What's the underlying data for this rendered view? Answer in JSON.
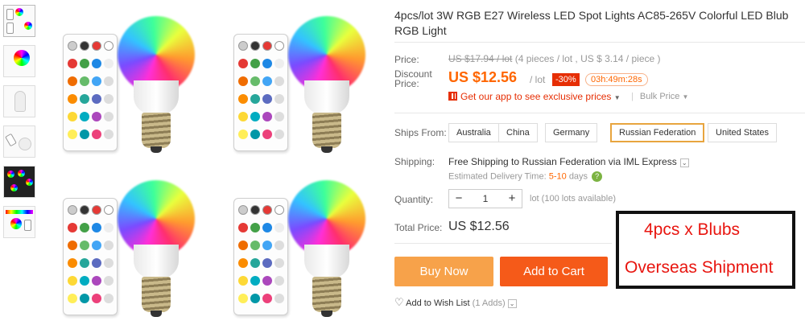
{
  "product": {
    "title": "4pcs/lot 3W RGB E27 Wireless LED Spot Lights AC85-265V Colorful LED Blub RGB Light"
  },
  "thumbnails": [
    "4-pack view",
    "single bulb",
    "bulb front",
    "bulb with remote",
    "color effects",
    "color spectrum"
  ],
  "price": {
    "label": "Price:",
    "original": "US $17.94 / lot",
    "per_piece": "(4 pieces / lot , US $ 3.14 / piece )",
    "discount_label": "Discount Price:",
    "sale": "US $12.56",
    "per_lot": "/ lot",
    "discount_badge": "-30%",
    "countdown": "03h:49m:28s",
    "app_promo": "Get our app to see exclusive prices",
    "bulk": "Bulk Price"
  },
  "ships_from": {
    "label": "Ships From:",
    "options": [
      "Australia",
      "China",
      "Germany",
      "Russian Federation",
      "United States"
    ],
    "selected": "Russian Federation"
  },
  "shipping": {
    "label": "Shipping:",
    "text": "Free Shipping to Russian Federation via IML Express",
    "delivery_label": "Estimated Delivery Time:",
    "delivery_value": "5-10",
    "delivery_unit": "days"
  },
  "quantity": {
    "label": "Quantity:",
    "value": "1",
    "available": "lot (100 lots available)"
  },
  "total": {
    "label": "Total Price:",
    "value": "US $12.56"
  },
  "actions": {
    "buy_now": "Buy Now",
    "add_to_cart": "Add to Cart",
    "wish_list": "Add to Wish List",
    "wish_count": "(1 Adds)"
  },
  "overlay": {
    "line1": "4pcs x Blubs",
    "line2": "Overseas Shipment"
  },
  "colors": {
    "accent_orange": "#ff6600",
    "buy_now_bg": "#f7a24a",
    "add_to_cart_bg": "#f55a19",
    "overlay_text": "#e8150f"
  }
}
